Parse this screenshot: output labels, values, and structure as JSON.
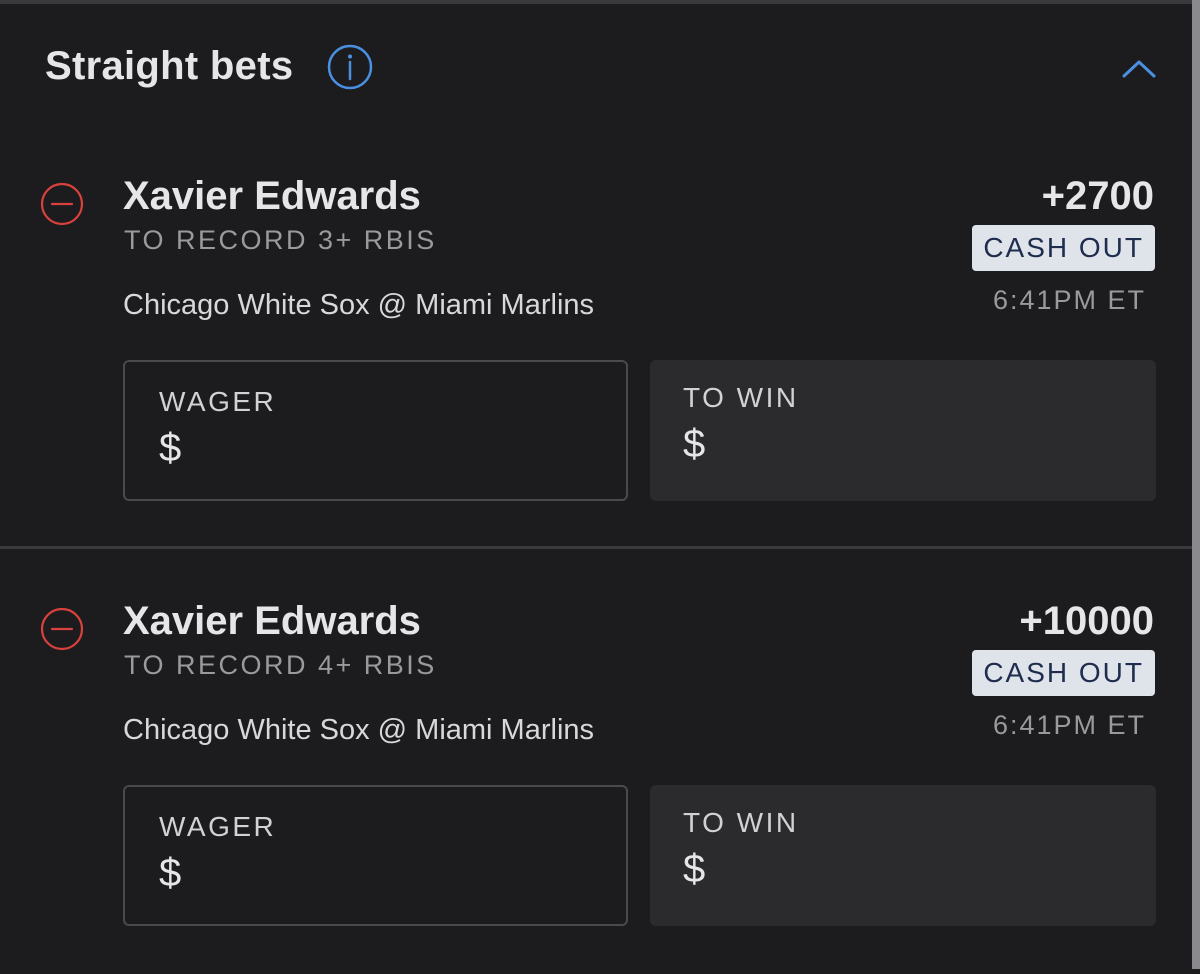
{
  "section": {
    "title": "Straight bets",
    "info_icon": "info-icon",
    "toggle_icon": "chevron-up-icon"
  },
  "colors": {
    "background": "#1c1c1e",
    "accent_blue": "#4a90e2",
    "remove_red": "#d9413c",
    "cashout_bg": "#dfe3ea",
    "cashout_text": "#1e2c4d"
  },
  "bets": [
    {
      "player": "Xavier Edwards",
      "market": "TO RECORD 3+ RBIS",
      "matchup": "Chicago White Sox @ Miami Marlins",
      "odds": "+2700",
      "cashout_label": "CASH OUT",
      "time": "6:41PM ET",
      "wager_label": "WAGER",
      "wager_value": "$",
      "towin_label": "TO WIN",
      "towin_value": "$"
    },
    {
      "player": "Xavier Edwards",
      "market": "TO RECORD 4+ RBIS",
      "matchup": "Chicago White Sox @ Miami Marlins",
      "odds": "+10000",
      "cashout_label": "CASH OUT",
      "time": "6:41PM ET",
      "wager_label": "WAGER",
      "wager_value": "$",
      "towin_label": "TO WIN",
      "towin_value": "$"
    }
  ]
}
